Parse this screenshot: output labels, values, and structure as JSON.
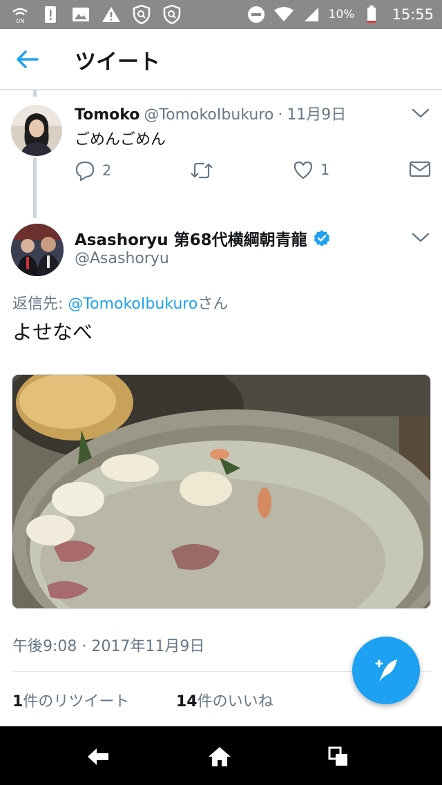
{
  "status_bar": {
    "battery": "10%",
    "time": "15:55"
  },
  "header": {
    "title": "ツイート"
  },
  "tweet_parent": {
    "name": "Tomoko",
    "handle": "@TomokoIbukuro",
    "separator": "·",
    "date": "11月9日",
    "text": "ごめんごめん",
    "reply_count": "2",
    "retweet_count": "",
    "like_count": "1"
  },
  "tweet_main": {
    "name": "Asashoryu 第68代横綱朝青龍",
    "handle": "@Asashoryu",
    "reply_to_label": "返信先: ",
    "reply_to_handle": "@TomokoIbukuro",
    "reply_to_suffix": "さん",
    "text": "よせなべ",
    "timestamp": "午後9:08 · 2017年11月9日",
    "retweets_num": "1",
    "retweets_label": "件のリツイート",
    "likes_num": "14",
    "likes_label": "件のいいね"
  },
  "colors": {
    "accent": "#1da1f2",
    "muted": "#657786",
    "text": "#14171a",
    "status_bar": "#8a8a8a"
  }
}
